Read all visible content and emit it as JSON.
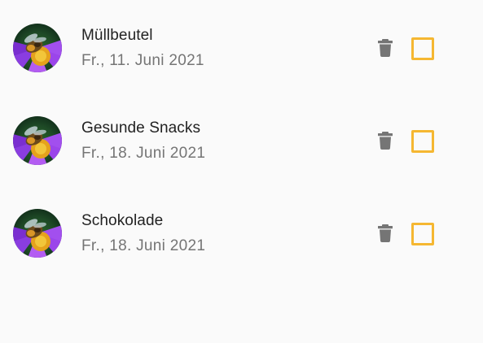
{
  "items": [
    {
      "title": "Müllbeutel",
      "date": "Fr., 11. Juni 2021",
      "avatar_icon": "bee-on-flower-photo",
      "delete_icon": "trash-icon",
      "checked": false
    },
    {
      "title": "Gesunde Snacks",
      "date": "Fr., 18. Juni 2021",
      "avatar_icon": "bee-on-flower-photo",
      "delete_icon": "trash-icon",
      "checked": false
    },
    {
      "title": "Schokolade",
      "date": "Fr., 18. Juni 2021",
      "avatar_icon": "bee-on-flower-photo",
      "delete_icon": "trash-icon",
      "checked": false
    }
  ],
  "colors": {
    "background": "#fafafa",
    "checkbox_border": "#f5b731",
    "trash_icon": "#757575",
    "title_text": "#222222",
    "date_text": "#757575"
  }
}
